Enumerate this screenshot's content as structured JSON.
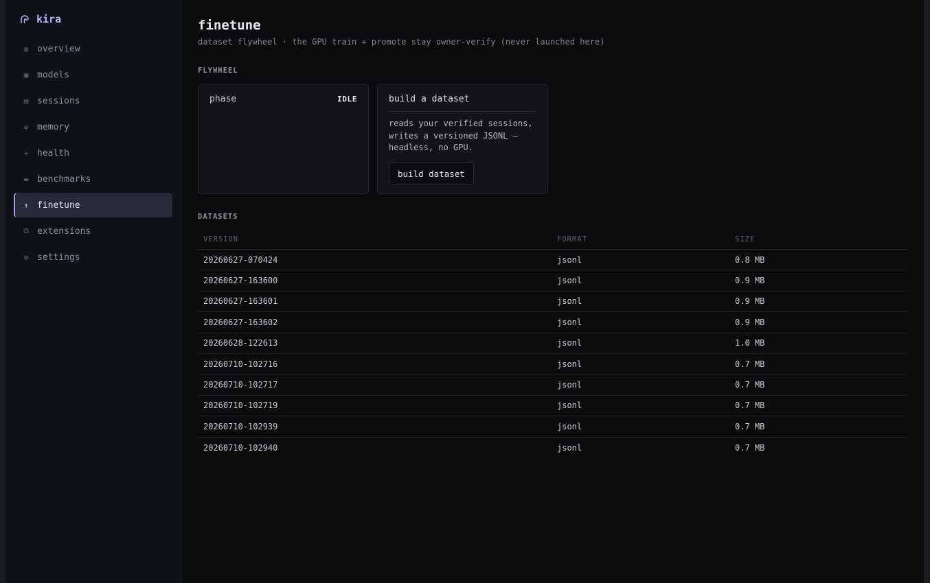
{
  "app": {
    "name": "kira"
  },
  "sidebar": {
    "items": [
      {
        "label": "overview",
        "icon": "globe-icon",
        "glyph": "◍"
      },
      {
        "label": "models",
        "icon": "cube-icon",
        "glyph": "▣"
      },
      {
        "label": "sessions",
        "icon": "list-icon",
        "glyph": "▤"
      },
      {
        "label": "memory",
        "icon": "crosshair-icon",
        "glyph": "⊕"
      },
      {
        "label": "health",
        "icon": "plus-icon",
        "glyph": "+"
      },
      {
        "label": "benchmarks",
        "icon": "bar-icon",
        "glyph": "▬"
      },
      {
        "label": "finetune",
        "icon": "arrow-up-icon",
        "glyph": "↟",
        "active": true
      },
      {
        "label": "extensions",
        "icon": "puzzle-icon",
        "glyph": "⧉"
      },
      {
        "label": "settings",
        "icon": "gear-icon",
        "glyph": "⚙"
      }
    ]
  },
  "page": {
    "title": "finetune",
    "subtitle": "dataset flywheel · the GPU train + promote stay owner-verify (never launched here)"
  },
  "flywheel": {
    "section_label": "FLYWHEEL",
    "phase_label": "phase",
    "phase_value": "IDLE",
    "build_title": "build a dataset",
    "build_desc": "reads your verified sessions, writes a versioned JSONL — headless, no GPU.",
    "build_button": "build dataset"
  },
  "datasets": {
    "section_label": "DATASETS",
    "columns": [
      "VERSION",
      "FORMAT",
      "SIZE"
    ],
    "rows": [
      [
        "20260627-070424",
        "jsonl",
        "0.8 MB"
      ],
      [
        "20260627-163600",
        "jsonl",
        "0.9 MB"
      ],
      [
        "20260627-163601",
        "jsonl",
        "0.9 MB"
      ],
      [
        "20260627-163602",
        "jsonl",
        "0.9 MB"
      ],
      [
        "20260628-122613",
        "jsonl",
        "1.0 MB"
      ],
      [
        "20260710-102716",
        "jsonl",
        "0.7 MB"
      ],
      [
        "20260710-102717",
        "jsonl",
        "0.7 MB"
      ],
      [
        "20260710-102719",
        "jsonl",
        "0.7 MB"
      ],
      [
        "20260710-102939",
        "jsonl",
        "0.7 MB"
      ],
      [
        "20260710-102940",
        "jsonl",
        "0.7 MB"
      ]
    ]
  },
  "colors": {
    "accent": "#9aa8ff",
    "background": "#0a0b0d",
    "sidebar": "#0e1115"
  }
}
